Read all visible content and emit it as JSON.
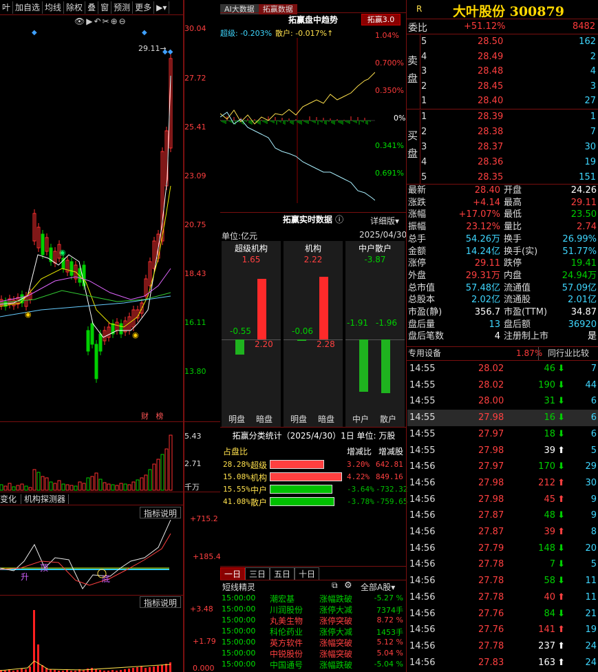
{
  "toolbar": {
    "items": [
      "叶",
      "加自选",
      "均线",
      "除权",
      "叠",
      "窗",
      "预测",
      "更多"
    ]
  },
  "kline": {
    "prices": [
      "30.04",
      "27.72",
      "25.41",
      "23.09",
      "20.75",
      "18.43",
      "16.11",
      "13.80"
    ],
    "high_marker": "29.11",
    "bottom_tabs": [
      "财",
      "榜"
    ],
    "vol_labels": [
      "5.43",
      "2.71",
      "千万"
    ],
    "ind_tabs": [
      "变化",
      "机构探测器"
    ],
    "ind_btn": "指标说明",
    "ind1_labels": [
      "+715.2",
      "+185.4"
    ],
    "ind1_marks": [
      "升",
      "顶",
      "底"
    ],
    "ind2_btn": "指标说明",
    "ind2_labels": [
      "+3.48",
      "+1.79",
      "0.000"
    ]
  },
  "mid": {
    "tabs": [
      "AI大数据",
      "拓赢数据"
    ],
    "trend_title": "拓赢盘中趋势",
    "trend_btn": "拓赢3.0",
    "super_label": "超级: -0.203%",
    "retail_label": "散户: -0.017%↑",
    "pct": [
      "1.04%",
      "0.700%",
      "0.350%",
      "0%",
      "0.341%",
      "0.691%"
    ],
    "rt_title": "拓赢实时数据",
    "detail": "详细版",
    "unit": "单位:亿元",
    "date": "2025/04/30",
    "groups": [
      {
        "name": "超级机构",
        "top": "1.65",
        "a": "-0.55",
        "b": "2.20",
        "l1": "明盘",
        "l2": "暗盘"
      },
      {
        "name": "机构",
        "top": "2.22",
        "a": "-0.06",
        "b": "2.28",
        "l1": "明盘",
        "l2": "暗盘"
      },
      {
        "name": "中户散户",
        "top": "-3.87",
        "a": "-1.91",
        "b": "-1.96",
        "l1": "中户",
        "l2": "散户"
      }
    ],
    "cls_title": "拓赢分类统计（2025/4/30）1日  单位: 万股",
    "cls_head": [
      "占盘比",
      "增减比",
      "增减股"
    ],
    "cls_rows": [
      {
        "pct": "28.28%",
        "name": "超级",
        "ratio": "3.20%",
        "shares": "642.81",
        "color": "#ff4040"
      },
      {
        "pct": "15.08%",
        "name": "机构",
        "ratio": "4.22%",
        "shares": "849.16",
        "color": "#ff4040"
      },
      {
        "pct": "15.55%",
        "name": "中户",
        "ratio": "-3.64%",
        "shares": "-732.32",
        "color": "#00c000"
      },
      {
        "pct": "41.08%",
        "name": "散户",
        "ratio": "-3.78%",
        "shares": "-759.65",
        "color": "#00c000"
      }
    ],
    "day_tabs": [
      "一日",
      "三日",
      "五日",
      "十日"
    ],
    "news_title": "短线精灵",
    "news_filter": "全部A股",
    "news": [
      {
        "t": "15:00:00",
        "n": "潮宏基",
        "e": "涨幅跌破",
        "v": "-5.27 %",
        "c": "g"
      },
      {
        "t": "15:00:00",
        "n": "川润股份",
        "e": "涨停大减",
        "v": "7374手",
        "c": "g"
      },
      {
        "t": "15:00:00",
        "n": "丸美生物",
        "e": "涨停突破",
        "v": "8.72 %",
        "c": "r"
      },
      {
        "t": "15:00:00",
        "n": "科伦药业",
        "e": "涨停大减",
        "v": "1453手",
        "c": "g"
      },
      {
        "t": "15:00:00",
        "n": "英方软件",
        "e": "涨幅突破",
        "v": "5.12 %",
        "c": "r"
      },
      {
        "t": "15:00:00",
        "n": "中锐股份",
        "e": "涨幅突破",
        "v": "5.04 %",
        "c": "r"
      },
      {
        "t": "15:00:00",
        "n": "中国通号",
        "e": "涨幅跌破",
        "v": "-5.04 %",
        "c": "g"
      }
    ]
  },
  "right": {
    "r": "R",
    "title": "大叶股份 300879",
    "wb_label": "委比",
    "wb_pct": "+51.12%",
    "wb_val": "8482",
    "sell_label": "卖盘",
    "buy_label": "买盘",
    "asks": [
      {
        "l": "5",
        "p": "28.50",
        "v": "162"
      },
      {
        "l": "4",
        "p": "28.49",
        "v": "2"
      },
      {
        "l": "3",
        "p": "28.48",
        "v": "4"
      },
      {
        "l": "2",
        "p": "28.45",
        "v": "3"
      },
      {
        "l": "1",
        "p": "28.40",
        "v": "27"
      }
    ],
    "bids": [
      {
        "l": "1",
        "p": "28.39",
        "v": "1"
      },
      {
        "l": "2",
        "p": "28.38",
        "v": "7"
      },
      {
        "l": "3",
        "p": "28.37",
        "v": "30"
      },
      {
        "l": "4",
        "p": "28.36",
        "v": "19"
      },
      {
        "l": "5",
        "p": "28.35",
        "v": "151"
      }
    ],
    "stats": [
      [
        "最新",
        "28.40",
        "r",
        "开盘",
        "24.26",
        "w"
      ],
      [
        "涨跌",
        "+4.14",
        "r",
        "最高",
        "29.11",
        "r"
      ],
      [
        "涨幅",
        "+17.07%",
        "r",
        "最低",
        "23.50",
        "g"
      ],
      [
        "振幅",
        "23.12%",
        "r",
        "量比",
        "2.74",
        "r"
      ],
      [
        "总手",
        "54.26万",
        "c",
        "换手",
        "26.99%",
        "c"
      ],
      [
        "金额",
        "14.24亿",
        "c",
        "换手(实)",
        "51.77%",
        "c"
      ],
      [
        "涨停",
        "29.11",
        "r",
        "跌停",
        "19.41",
        "g"
      ],
      [
        "外盘",
        "29.31万",
        "r",
        "内盘",
        "24.94万",
        "g"
      ],
      [
        "总市值",
        "57.48亿",
        "c",
        "流通值",
        "57.09亿",
        "c"
      ],
      [
        "总股本",
        "2.02亿",
        "c",
        "流通股",
        "2.01亿",
        "c"
      ],
      [
        "市盈(静)",
        "356.7",
        "w",
        "市盈(TTM)",
        "34.87",
        "w"
      ],
      [
        "盘后量",
        "13",
        "c",
        "盘后额",
        "36920",
        "c"
      ],
      [
        "盘后笔数",
        "4",
        "w",
        "注册制上市",
        "是",
        "w"
      ]
    ],
    "equip": "专用设备",
    "equip_pct": "1.87%",
    "compare": "同行业比较",
    "ticks": [
      [
        "14:55",
        "28.02",
        "46",
        "g",
        "7"
      ],
      [
        "14:55",
        "28.02",
        "190",
        "g",
        "44"
      ],
      [
        "14:55",
        "28.00",
        "31",
        "g",
        "6"
      ],
      [
        "14:55",
        "27.98",
        "16",
        "g",
        "6"
      ],
      [
        "14:55",
        "27.97",
        "18",
        "g",
        "6"
      ],
      [
        "14:55",
        "27.98",
        "39",
        "w",
        "5"
      ],
      [
        "14:56",
        "27.97",
        "170",
        "g",
        "29"
      ],
      [
        "14:56",
        "27.98",
        "212",
        "r",
        "30"
      ],
      [
        "14:56",
        "27.98",
        "45",
        "r",
        "9"
      ],
      [
        "14:56",
        "27.87",
        "48",
        "g",
        "9"
      ],
      [
        "14:56",
        "27.87",
        "39",
        "r",
        "8"
      ],
      [
        "14:56",
        "27.79",
        "148",
        "g",
        "20"
      ],
      [
        "14:56",
        "27.78",
        "7",
        "g",
        "5"
      ],
      [
        "14:56",
        "27.78",
        "58",
        "g",
        "11"
      ],
      [
        "14:56",
        "27.78",
        "40",
        "r",
        "11"
      ],
      [
        "14:56",
        "27.76",
        "84",
        "g",
        "21"
      ],
      [
        "14:56",
        "27.76",
        "141",
        "r",
        "19"
      ],
      [
        "14:56",
        "27.78",
        "237",
        "w",
        "24"
      ],
      [
        "14:56",
        "27.83",
        "163",
        "w",
        "24"
      ]
    ]
  }
}
